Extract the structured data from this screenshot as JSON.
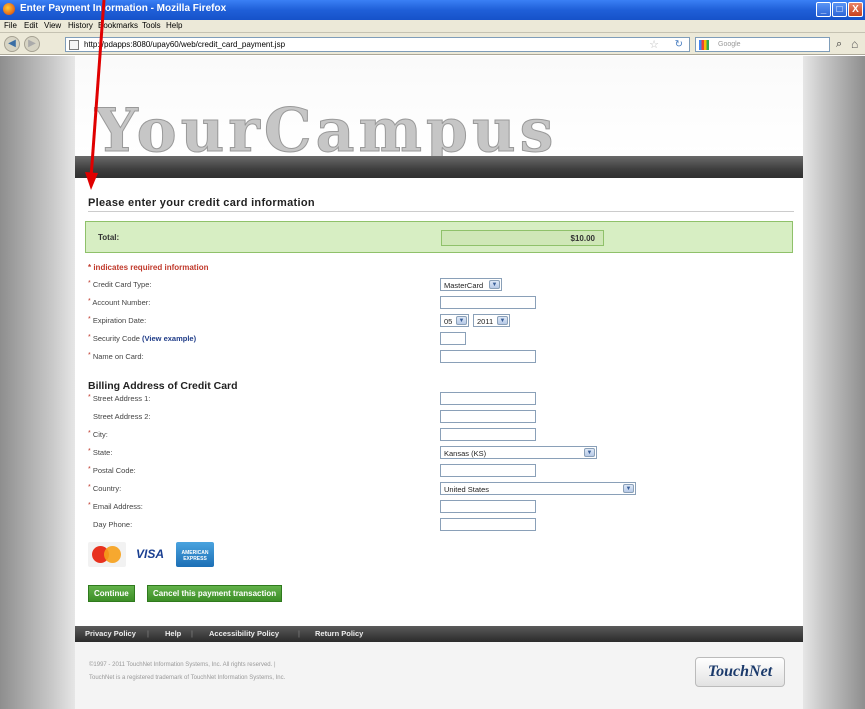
{
  "window": {
    "title": "Enter Payment Information - Mozilla Firefox",
    "minimize": "_",
    "maximize": "□",
    "close": "X"
  },
  "menu": [
    "File",
    "Edit",
    "View",
    "History",
    "Bookmarks",
    "Tools",
    "Help"
  ],
  "nav": {
    "url": "http://pdapps:8080/upay60/web/credit_card_payment.jsp",
    "search_placeholder": "Google",
    "back_icon": "back-arrow-icon",
    "forward_icon": "forward-arrow-icon"
  },
  "banner": {
    "logo": "YourCampus"
  },
  "form": {
    "heading": "Please enter your credit card information",
    "total_label": "Total:",
    "total_value": "$10.00",
    "required_note": "* indicates required information",
    "card_type_label": "Credit Card Type:",
    "card_type_value": "MasterCard",
    "account_number_label": "Account Number:",
    "account_number_value": "",
    "expiration_label": "Expiration Date:",
    "exp_month": "05",
    "exp_year": "2011",
    "security_code_label": "Security Code",
    "security_code_link": "(View example)",
    "security_code_value": "",
    "name_label": "Name on Card:",
    "name_value": "",
    "billing_heading": "Billing Address of Credit Card",
    "street1_label": "Street Address 1:",
    "street2_label": "Street Address 2:",
    "city_label": "City:",
    "state_label": "State:",
    "state_value": "Kansas (KS)",
    "postal_label": "Postal Code:",
    "country_label": "Country:",
    "country_value": "United States",
    "email_label": "Email Address:",
    "phone_label": "Day Phone:",
    "asterisk": "*"
  },
  "cards": {
    "visa": "VISA",
    "amex": "AMERICAN EXPRESS"
  },
  "buttons": {
    "continue": "Continue",
    "cancel": "Cancel this payment transaction"
  },
  "footer": {
    "links": [
      "Privacy Policy",
      "Help",
      "Accessibility Policy",
      "Return Policy"
    ],
    "separator": "|",
    "copyright_line1": "©1997 - 2011 TouchNet Information Systems, Inc. All rights reserved. |",
    "copyright_line2": "TouchNet is a registered trademark of TouchNet Information Systems, Inc.",
    "logo": "TouchNet"
  },
  "colors": {
    "accent_green": "#3c8e27",
    "total_bg": "#d7eec3",
    "required_red": "#c0392b",
    "annotation_arrow": "#e00000"
  }
}
